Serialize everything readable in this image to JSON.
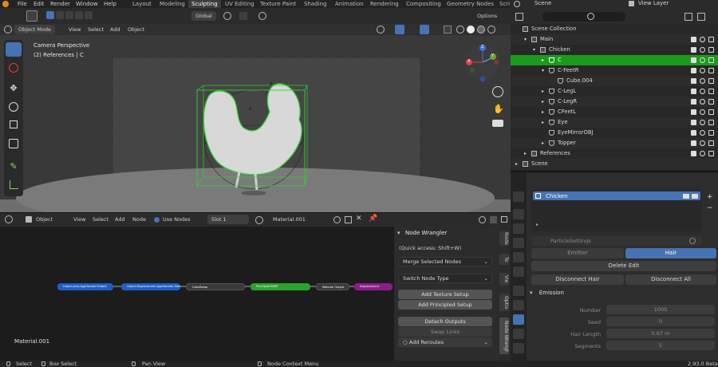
{
  "colors": {
    "accent": "#4772b3",
    "selection": "#1b9b1b",
    "orange": "#e08a1c"
  },
  "topbar": {
    "menus": [
      "File",
      "Edit",
      "Render",
      "Window",
      "Help"
    ],
    "workspaces": [
      "Layout",
      "Modeling",
      "Sculpting",
      "UV Editing",
      "Texture Paint",
      "Shading",
      "Animation",
      "Rendering",
      "Compositing",
      "Geometry Nodes",
      "Scri"
    ],
    "active_workspace": "Sculpting"
  },
  "viewport": {
    "transform_label": "Global",
    "options_label": "Options",
    "mode": "Object Mode",
    "menus": [
      "View",
      "Select",
      "Add",
      "Object"
    ],
    "overlay_title": "Camera Perspective",
    "overlay_subtitle": "(2) References | C",
    "gizmo": {
      "x": "X",
      "y": "Y",
      "z": "Z"
    }
  },
  "node_editor": {
    "editor_type": "Object",
    "menus": [
      "View",
      "Select",
      "Add",
      "Node"
    ],
    "use_nodes": "Use Nodes",
    "slot": "Slot 1",
    "material": "Material.001",
    "footer_material": "Material.001",
    "nodes": [
      {
        "label": "Object.Joint.AppHandler.Trident",
        "color": "#1f5fc4"
      },
      {
        "label": "Object.Displacement.AppHandler.Trident",
        "color": "#1f5fc4"
      },
      {
        "label": "ColorRamp",
        "color": "#3a3a3a"
      },
      {
        "label": "Principled BSDF",
        "color": "#2ea02e"
      },
      {
        "label": "Material Output",
        "color": "#3a3a3a"
      },
      {
        "label": "Displacement",
        "color": "#8a1e8a"
      }
    ]
  },
  "node_wrangler": {
    "title": "Node Wrangler",
    "quick_access": "(Quick access: Shift+W)",
    "merge_selected": "Merge Selected Nodes",
    "switch_type": "Switch Node Type",
    "add_texture_setup": "Add Texture Setup",
    "add_principled_setup": "Add Principled Setup",
    "detach_outputs": "Detach Outputs",
    "swap_links": "Swap Links",
    "add_reroutes": "Add Reroutes",
    "tabs": [
      "Node",
      "To",
      "Vie",
      "Optio",
      "Node Wrangl"
    ]
  },
  "statusbar": {
    "select": "Select",
    "box_select": "Box Select",
    "pan_view": "Pan View",
    "context_menu": "Node Context Menu",
    "version": "2.93.0 Beta"
  },
  "outliner": {
    "scene_label": "Scene",
    "view_layer_label": "View Layer",
    "rows": [
      {
        "label": "Scene Collection",
        "indent": 0,
        "expand": "",
        "sel": false
      },
      {
        "label": "Main",
        "indent": 1,
        "expand": "▾",
        "sel": false
      },
      {
        "label": "Chicken",
        "indent": 2,
        "expand": "▾",
        "sel": false
      },
      {
        "label": "C",
        "indent": 3,
        "expand": "▸",
        "sel": true
      },
      {
        "label": "C-FeetR",
        "indent": 3,
        "expand": "▾",
        "sel": false
      },
      {
        "label": "Cube.004",
        "indent": 4,
        "expand": "",
        "sel": false
      },
      {
        "label": "C-LegL",
        "indent": 3,
        "expand": "▸",
        "sel": false
      },
      {
        "label": "C-LegR",
        "indent": 3,
        "expand": "▸",
        "sel": false
      },
      {
        "label": "CFeetL",
        "indent": 3,
        "expand": "▸",
        "sel": false
      },
      {
        "label": "Eye",
        "indent": 3,
        "expand": "▸",
        "sel": false
      },
      {
        "label": "EyeMirrorOBJ",
        "indent": 3,
        "expand": "",
        "sel": false
      },
      {
        "label": "Topper",
        "indent": 3,
        "expand": "▸",
        "sel": false
      },
      {
        "label": "References",
        "indent": 1,
        "expand": "▸",
        "sel": false
      },
      {
        "label": "Scene",
        "indent": 0,
        "expand": "▸",
        "sel": false
      }
    ]
  },
  "properties": {
    "particle_system": "Chicken",
    "settings_name": "ParticleSettings",
    "emitter": "Emitter",
    "hair": "Hair",
    "delete_edit": "Delete Edit",
    "disconnect_hair": "Disconnect Hair",
    "disconnect_all": "Disconnect All",
    "emission_title": "Emission",
    "fields": [
      {
        "label": "Number",
        "value": "1000"
      },
      {
        "label": "Seed",
        "value": "0"
      },
      {
        "label": "Hair Length",
        "value": "0.67 m"
      },
      {
        "label": "Segments",
        "value": "5"
      }
    ]
  }
}
